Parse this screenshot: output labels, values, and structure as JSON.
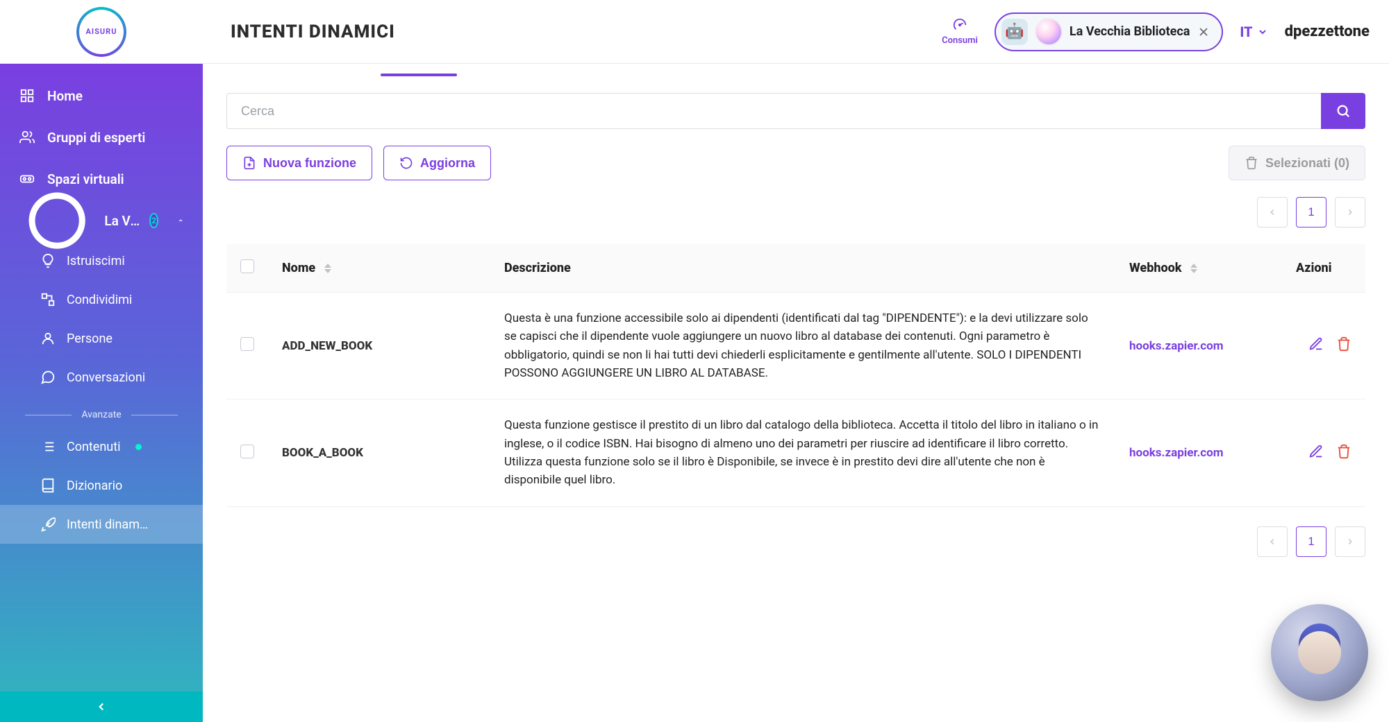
{
  "brand": "AISURU",
  "page_title": "INTENTI DINAMICI",
  "consumi_label": "Consumi",
  "project_chip": {
    "label": "La Vecchia Biblioteca"
  },
  "lang": "IT",
  "user": "dpezzettone",
  "sidebar": {
    "items": [
      {
        "id": "home",
        "label": "Home"
      },
      {
        "id": "gruppi",
        "label": "Gruppi di esperti"
      },
      {
        "id": "spazi",
        "label": "Spazi virtuali"
      }
    ],
    "group": {
      "label": "La Vecchia …",
      "badge": "2"
    },
    "subs": [
      {
        "id": "istruiscimi",
        "label": "Istruiscimi"
      },
      {
        "id": "condividimi",
        "label": "Condividimi"
      },
      {
        "id": "persone",
        "label": "Persone"
      },
      {
        "id": "conversazioni",
        "label": "Conversazioni"
      }
    ],
    "sectionTitle": "Avanzate",
    "adv": [
      {
        "id": "contenuti",
        "label": "Contenuti",
        "dot": true
      },
      {
        "id": "dizionario",
        "label": "Dizionario"
      },
      {
        "id": "intenti",
        "label": "Intenti dinam…",
        "active": true
      }
    ]
  },
  "search": {
    "placeholder": "Cerca"
  },
  "buttons": {
    "nuova": "Nuova funzione",
    "aggiorna": "Aggiorna",
    "selezionati": "Selezionati (0)"
  },
  "pagination": {
    "page": "1"
  },
  "table": {
    "headers": {
      "nome": "Nome",
      "descrizione": "Descrizione",
      "webhook": "Webhook",
      "azioni": "Azioni"
    },
    "rows": [
      {
        "nome": "ADD_NEW_BOOK",
        "desc": "Questa è una funzione accessibile solo ai dipendenti (identificati dal tag \"DIPENDENTE\"): e la devi utilizzare solo se capisci che il dipendente vuole aggiungere un nuovo libro al database dei contenuti. Ogni parametro è obbligatorio, quindi se non li hai tutti devi chiederli esplicitamente e gentilmente all'utente. SOLO I DIPENDENTI POSSONO AGGIUNGERE UN LIBRO AL DATABASE.",
        "hook": "hooks.zapier.com"
      },
      {
        "nome": "BOOK_A_BOOK",
        "desc": "Questa funzione gestisce il prestito di un libro dal catalogo della biblioteca. Accetta il titolo del libro in italiano o in inglese, o il codice ISBN. Hai bisogno di almeno uno dei parametri per riuscire ad identificare il libro corretto. Utilizza questa funzione solo se il libro è Disponibile, se invece è in prestito devi dire all'utente che non è disponibile quel libro.",
        "hook": "hooks.zapier.com"
      }
    ]
  }
}
